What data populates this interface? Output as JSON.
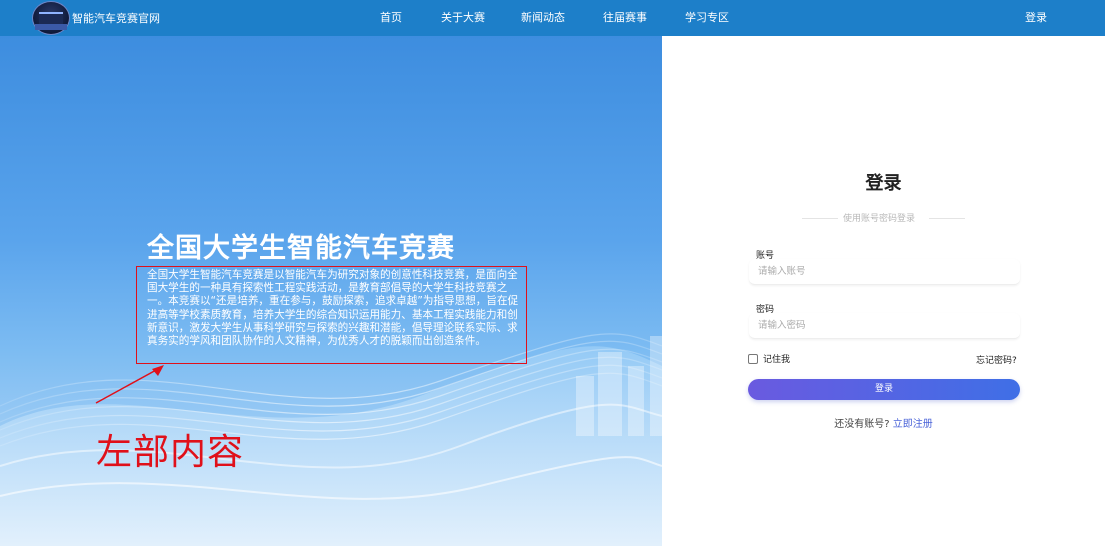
{
  "header": {
    "brand_title": "智能汽车竞赛官网",
    "nav": [
      {
        "label": "首页"
      },
      {
        "label": "关于大赛"
      },
      {
        "label": "新闻动态"
      },
      {
        "label": "往届赛事"
      },
      {
        "label": "学习专区"
      }
    ],
    "login_label": "登录",
    "bg_color": "#1d7fc9"
  },
  "hero": {
    "title": "全国大学生智能汽车竞赛",
    "description": "全国大学生智能汽车竞赛是以智能汽车为研究对象的创意性科技竞赛，是面向全国大学生的一种具有探索性工程实践活动，是教育部倡导的大学生科技竞赛之一。本竞赛以“还是培养，重在参与，鼓励探索，追求卓越”为指导思想，旨在促进高等学校素质教育，培养大学生的综合知识运用能力、基本工程实践能力和创新意识，激发大学生从事科学研究与探索的兴趣和潜能，倡导理论联系实际、求真务实的学风和团队协作的人文精神，为优秀人才的脱颖而出创造条件。",
    "annotation": "左部内容",
    "annotation_color": "#e0101a"
  },
  "login": {
    "title": "登录",
    "subtitle": "使用账号密码登录",
    "account_label": "账号",
    "account_placeholder": "请输入账号",
    "password_label": "密码",
    "password_placeholder": "请输入密码",
    "remember_label": "记住我",
    "forgot_label": "忘记密码?",
    "submit_label": "登录",
    "no_account_text": "还没有账号?",
    "register_label": "立即注册",
    "accent_color": "#4a63d8"
  }
}
